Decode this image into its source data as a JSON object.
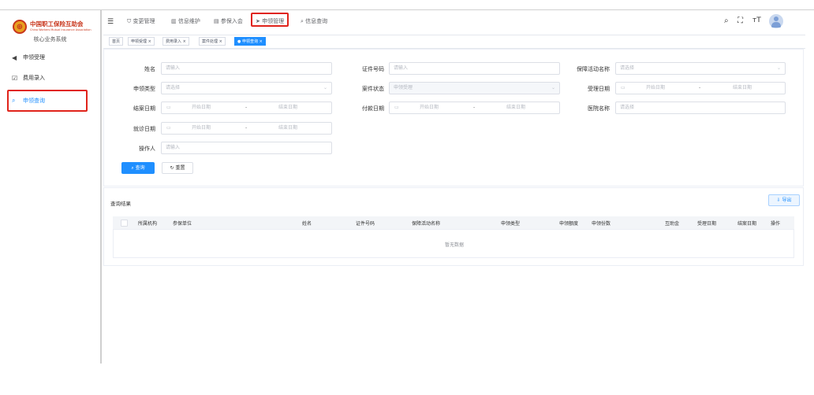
{
  "sidebar": {
    "logo_glyph": "⊕",
    "org_name": "中国职工保险互助会",
    "org_name_en": "China Workers Mutual Insurance Association",
    "system_name": "核心业务系统",
    "items": [
      {
        "label": "申领受理",
        "icon": "send-icon",
        "glyph": "◀"
      },
      {
        "label": "费用录入",
        "icon": "edit-icon",
        "glyph": "☑"
      },
      {
        "label": "申领查询",
        "icon": "search-icon",
        "glyph": "⌕",
        "active": true
      }
    ]
  },
  "topbar": {
    "menu_glyph": "☰",
    "nav": [
      {
        "label": "变更管理",
        "icon": "shield-icon",
        "glyph": "⛉"
      },
      {
        "label": "信息维护",
        "icon": "building-icon",
        "glyph": "▥"
      },
      {
        "label": "参保入会",
        "icon": "document-icon",
        "glyph": "▤"
      },
      {
        "label": "申领管理",
        "icon": "send-icon",
        "glyph": "➤",
        "selected": true
      },
      {
        "label": "信息查询",
        "icon": "search-icon",
        "glyph": "⌕"
      }
    ],
    "tools": {
      "search": "⌕",
      "fullscreen": "⛶",
      "font_size": "тT"
    }
  },
  "tabs": [
    {
      "label": "首页",
      "closable": false
    },
    {
      "label": "申领受理",
      "closable": true
    },
    {
      "label": "费用录入",
      "closable": true
    },
    {
      "label": "案件处理",
      "closable": true
    },
    {
      "label": "申领查询",
      "closable": true,
      "active": true
    }
  ],
  "form": {
    "name": {
      "label": "姓名",
      "placeholder": "请输入"
    },
    "id_number": {
      "label": "证件号码",
      "placeholder": "请输入"
    },
    "activity": {
      "label": "保障活动名称",
      "placeholder": "请选择"
    },
    "claim_type": {
      "label": "申领类型",
      "placeholder": "请选择"
    },
    "case_status": {
      "label": "案件状态",
      "value": "申领受理"
    },
    "accept_date": {
      "label": "受理日期",
      "start": "开始日期",
      "sep": "-",
      "end": "结束日期"
    },
    "settle_date": {
      "label": "结案日期",
      "start": "开始日期",
      "sep": "-",
      "end": "结束日期"
    },
    "pay_date": {
      "label": "付款日期",
      "start": "开始日期",
      "sep": "-",
      "end": "结束日期"
    },
    "hospital": {
      "label": "医院名称",
      "placeholder": "请选择"
    },
    "visit_date": {
      "label": "就诊日期",
      "start": "开始日期",
      "sep": "-",
      "end": "结束日期"
    },
    "operator": {
      "label": "操作人",
      "placeholder": "请输入"
    },
    "query_button": "查询",
    "reset_button": "重置"
  },
  "results": {
    "title": "查询结果",
    "export_button": "导出",
    "columns": [
      "所属机构",
      "参保单位",
      "姓名",
      "证件号码",
      "保障活动名称",
      "申领类型",
      "申领额度",
      "申领份数",
      "互助金",
      "受理日期",
      "结案日期",
      "操作"
    ],
    "empty_text": "暂无数据"
  }
}
